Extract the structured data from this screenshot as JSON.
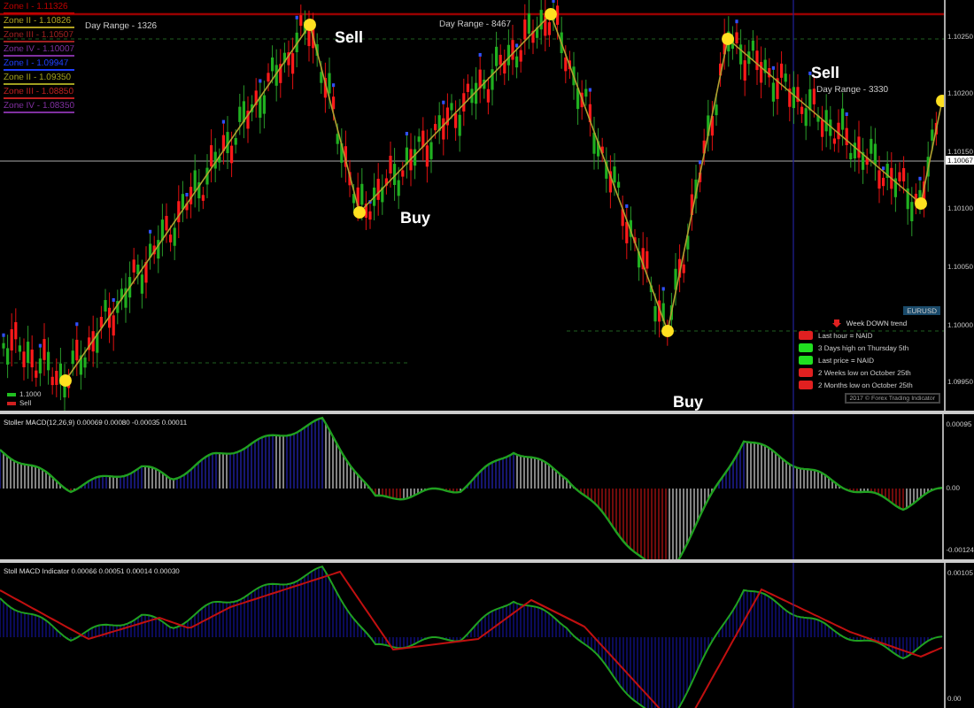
{
  "main_chart": {
    "zones": [
      {
        "label": "Zone I - 1.11326",
        "color": "#c00000"
      },
      {
        "label": "Zone II - 1.10826",
        "color": "#b0a020"
      },
      {
        "label": "Zone III - 1.10507",
        "color": "#a02020"
      },
      {
        "label": "Zone IV - 1.10007",
        "color": "#8030a0"
      },
      {
        "label": "Zone I - 1.09947",
        "color": "#2040ff"
      },
      {
        "label": "Zone II - 1.09350",
        "color": "#a0a020"
      },
      {
        "label": "Zone III - 1.08850",
        "color": "#c02020"
      },
      {
        "label": "Zone IV - 1.08350",
        "color": "#8030a0"
      }
    ],
    "annotations": [
      {
        "kind": "signal",
        "text": "Sell"
      },
      {
        "kind": "range",
        "text": "Day Range - 1326"
      },
      {
        "kind": "signal",
        "text": "Buy"
      },
      {
        "kind": "range",
        "text": "Day Range - 8467"
      },
      {
        "kind": "signal",
        "text": "Sell"
      },
      {
        "kind": "range",
        "text": "Day Range - 3330"
      },
      {
        "kind": "signal",
        "text": "Buy"
      }
    ],
    "price_axis": [
      "1.10250",
      "1.10200",
      "1.10150",
      "1.10100",
      "1.10050",
      "1.10000",
      "1.09950"
    ],
    "current_price": "1.10067",
    "legend": [
      {
        "text": "1.1000",
        "color": "#20c020"
      },
      {
        "text": "Sell",
        "color": "#d02020"
      }
    ]
  },
  "info_panel": {
    "symbol": "EURUSD",
    "trend": "Week DOWN trend",
    "rows": [
      {
        "text": "Last hour = NAID",
        "color": "#e02020"
      },
      {
        "text": "3 Days high on Thursday 5th",
        "color": "#20e020"
      },
      {
        "text": "Last price = NAID",
        "color": "#20e020"
      },
      {
        "text": "2 Weeks low on October 25th",
        "color": "#e02020"
      },
      {
        "text": "2 Months low on October 25th",
        "color": "#e02020"
      }
    ],
    "footer": "2017 © Forex Trading Indicator"
  },
  "indicators": [
    {
      "kind": "histogram",
      "title": "Stoller MACD(12,26,9) 0.00069 0.00080 -0.00035 0.00011",
      "axis": [
        "0.00095",
        "0.00",
        "-0.00124"
      ]
    },
    {
      "kind": "lines",
      "title": "Stoll MACD Indicator 0.00066 0.00051 0.00014 0.00030",
      "axis": [
        "0.00105",
        "0.00"
      ]
    }
  ]
}
